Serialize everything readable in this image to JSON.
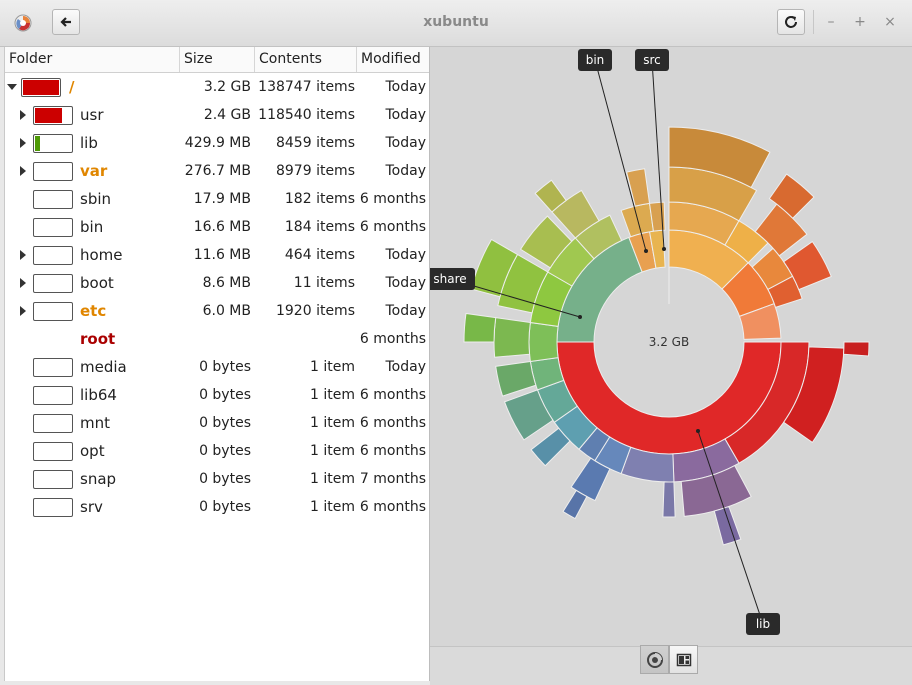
{
  "window": {
    "title": "xubuntu"
  },
  "columns": {
    "folder": "Folder",
    "size": "Size",
    "contents": "Contents",
    "modified": "Modified"
  },
  "rows": [
    {
      "name": "/",
      "size": "3.2 GB",
      "contents": "138747 items",
      "modified": "Today",
      "fill": 1.0
    },
    {
      "name": "usr",
      "size": "2.4 GB",
      "contents": "118540 items",
      "modified": "Today",
      "fill": 0.75
    },
    {
      "name": "lib",
      "size": "429.9 MB",
      "contents": "8459 items",
      "modified": "Today",
      "fill": 0.13
    },
    {
      "name": "var",
      "size": "276.7 MB",
      "contents": "8979 items",
      "modified": "Today",
      "fill": 0.0
    },
    {
      "name": "sbin",
      "size": "17.9 MB",
      "contents": "182 items",
      "modified": "6 months",
      "fill": 0.0
    },
    {
      "name": "bin",
      "size": "16.6 MB",
      "contents": "184 items",
      "modified": "6 months",
      "fill": 0.0
    },
    {
      "name": "home",
      "size": "11.6 MB",
      "contents": "464 items",
      "modified": "Today",
      "fill": 0.0
    },
    {
      "name": "boot",
      "size": "8.6 MB",
      "contents": "11 items",
      "modified": "Today",
      "fill": 0.0
    },
    {
      "name": "etc",
      "size": "6.0 MB",
      "contents": "1920 items",
      "modified": "Today",
      "fill": 0.0
    },
    {
      "name": "root",
      "size": "",
      "contents": "",
      "modified": "6 months",
      "fill": 0.0
    },
    {
      "name": "media",
      "size": "0 bytes",
      "contents": "1 item",
      "modified": "Today",
      "fill": 0.0
    },
    {
      "name": "lib64",
      "size": "0 bytes",
      "contents": "1 item",
      "modified": "6 months",
      "fill": 0.0
    },
    {
      "name": "mnt",
      "size": "0 bytes",
      "contents": "1 item",
      "modified": "6 months",
      "fill": 0.0
    },
    {
      "name": "opt",
      "size": "0 bytes",
      "contents": "1 item",
      "modified": "6 months",
      "fill": 0.0
    },
    {
      "name": "snap",
      "size": "0 bytes",
      "contents": "1 item",
      "modified": "7 months",
      "fill": 0.0
    },
    {
      "name": "srv",
      "size": "0 bytes",
      "contents": "1 item",
      "modified": "6 months",
      "fill": 0.0
    }
  ],
  "chart": {
    "center_label": "3.2 GB",
    "labels": {
      "bin": "bin",
      "src": "src",
      "share": "share",
      "lib": "lib"
    }
  },
  "colors": {
    "accent_red": "#cc0000",
    "warn_orange": "#e08600",
    "root_red": "#aa0000"
  },
  "icons": {
    "back": "arrow-left-icon",
    "refresh": "refresh-icon",
    "ring_view": "ring-chart-icon",
    "treemap_view": "treemap-icon"
  }
}
